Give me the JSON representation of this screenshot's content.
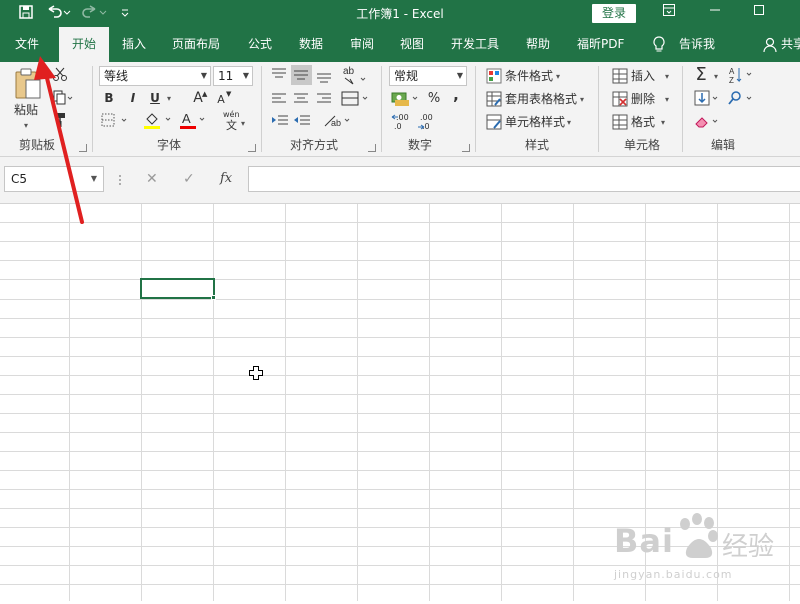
{
  "window": {
    "title": "工作簿1  -  Excel",
    "login_label": "登录"
  },
  "tabs": [
    {
      "label": "文件"
    },
    {
      "label": "开始"
    },
    {
      "label": "插入"
    },
    {
      "label": "页面布局"
    },
    {
      "label": "公式"
    },
    {
      "label": "数据"
    },
    {
      "label": "审阅"
    },
    {
      "label": "视图"
    },
    {
      "label": "开发工具"
    },
    {
      "label": "帮助"
    },
    {
      "label": "福昕PDF"
    },
    {
      "label": "告诉我"
    },
    {
      "label": "共享"
    }
  ],
  "ribbon": {
    "clipboard": {
      "paste_label": "粘贴",
      "group_label": "剪贴板"
    },
    "font": {
      "font_name": "等线",
      "font_size": "11",
      "bold": "B",
      "italic": "I",
      "underline": "U",
      "grow": "A",
      "shrink": "A",
      "wen": "wén",
      "wen_char": "文",
      "group_label": "字体"
    },
    "alignment": {
      "group_label": "对齐方式"
    },
    "number": {
      "format": "常规",
      "percent": "%",
      "comma": ",",
      "dec_inc": ".00",
      "dec_dec": ".00",
      "group_label": "数字"
    },
    "styles": {
      "conditional": "条件格式",
      "table": "套用表格格式",
      "cell": "单元格样式",
      "group_label": "样式"
    },
    "cells": {
      "insert": "插入",
      "delete": "删除",
      "format": "格式",
      "group_label": "单元格"
    },
    "editing": {
      "group_label": "编辑",
      "sum": "Σ",
      "sort": "AZ"
    }
  },
  "formula_bar": {
    "name_box": "C5",
    "cancel": "✕",
    "enter": "✓",
    "fx": "fx",
    "value": ""
  },
  "sheet": {
    "selected_cell": "C5"
  },
  "watermark": {
    "brand": "Bai",
    "brand_end": "经验",
    "url": "jingyan.baidu.com"
  },
  "colors": {
    "brand": "#217346",
    "ribbon_bg": "#f3f3f3",
    "arrow": "#e02020",
    "grid_line": "#d9d9d9"
  }
}
